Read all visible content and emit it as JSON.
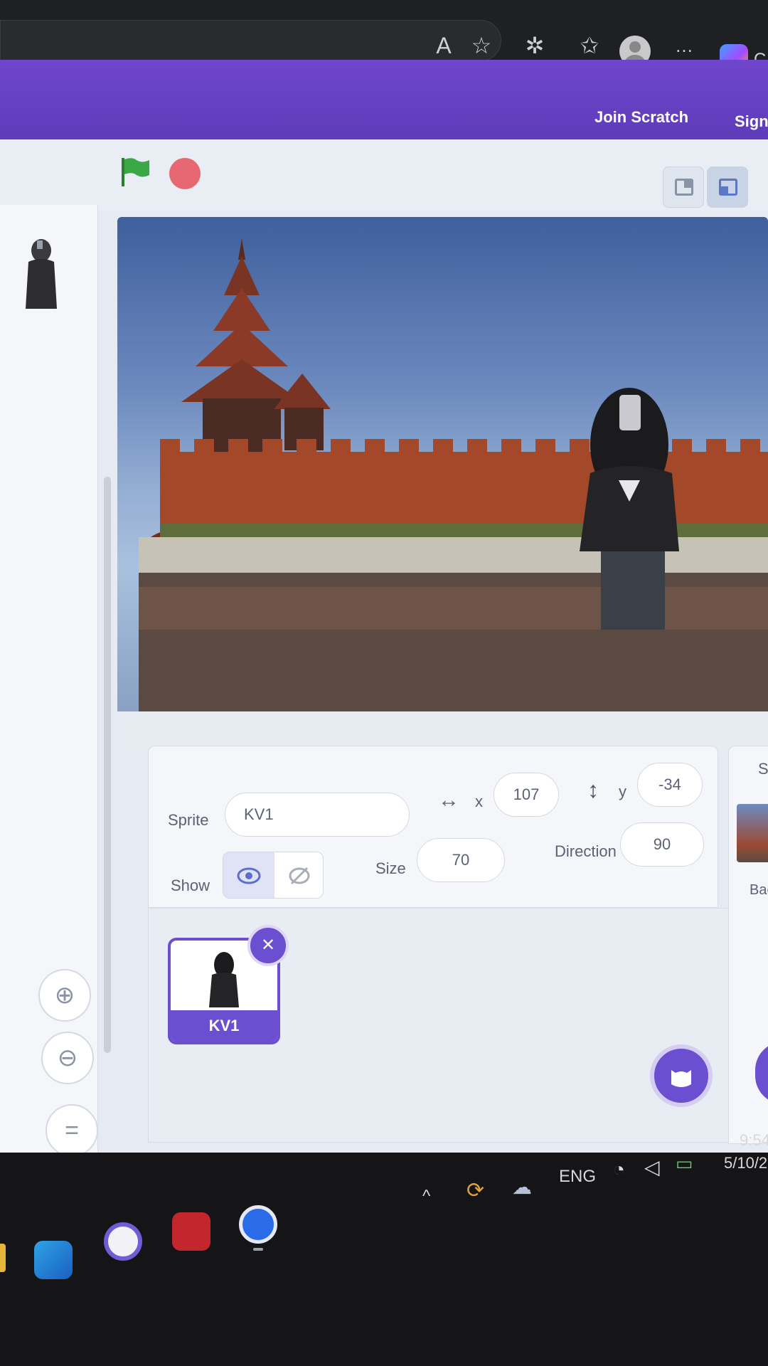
{
  "header": {
    "join_label": "Join Scratch",
    "sign_label": "Sign"
  },
  "stage_panel": {
    "tab_label": "Sta",
    "backdrop_label": "Bac"
  },
  "sprite_info": {
    "sprite_label": "Sprite",
    "sprite_name": "KV1",
    "x_label": "x",
    "x_value": "107",
    "y_label": "y",
    "y_value": "-34",
    "show_label": "Show",
    "size_label": "Size",
    "size_value": "70",
    "direction_label": "Direction",
    "direction_value": "90"
  },
  "sprites": [
    {
      "name": "KV1",
      "selected": true
    }
  ],
  "taskbar": {
    "language": "ENG",
    "time": "9:54",
    "date": "5/10/2"
  },
  "colors": {
    "scratch_purple": "#6b4fd0",
    "flag_green": "#2e9a3a",
    "stop_red": "#e6505a"
  },
  "icons": [
    "green-flag-icon",
    "stop-icon",
    "zoom-in-icon",
    "zoom-out-icon",
    "reset-zoom-icon",
    "eye-icon",
    "eye-off-icon",
    "trash-icon",
    "add-sprite-cat-icon"
  ]
}
